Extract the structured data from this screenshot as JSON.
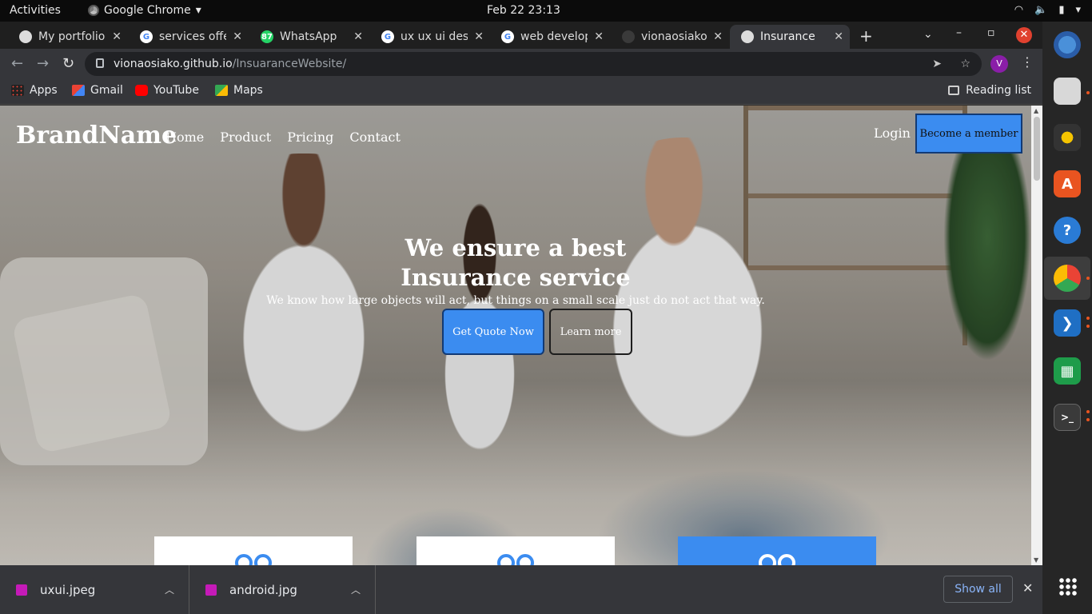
{
  "system_bar": {
    "activities": "Activities",
    "app_name": "Google Chrome",
    "datetime": "Feb 22  23:13"
  },
  "tabs": [
    {
      "label": "My portfolio",
      "icon": "globe-icon"
    },
    {
      "label": "services offe",
      "icon": "google-icon"
    },
    {
      "label": "WhatsApp",
      "icon": "whatsapp-icon",
      "badge": "87"
    },
    {
      "label": "ux ux ui desi",
      "icon": "google-icon"
    },
    {
      "label": "web develop",
      "icon": "google-icon"
    },
    {
      "label": "vionaosiako/",
      "icon": "github-icon"
    },
    {
      "label": "Insurance",
      "icon": "globe-icon",
      "active": true
    }
  ],
  "toolbar": {
    "url_host": "vionaosiako.github.io",
    "url_path": "/InsuaranceWebsite/",
    "profile_initial": "V"
  },
  "bookmarks": [
    {
      "label": "Apps",
      "icon": "apps-grid-icon"
    },
    {
      "label": "Gmail",
      "icon": "gmail-icon"
    },
    {
      "label": "YouTube",
      "icon": "youtube-icon"
    },
    {
      "label": "Maps",
      "icon": "maps-icon"
    }
  ],
  "reading_list": "Reading list",
  "site": {
    "brand": "BrandName",
    "nav": [
      "Home",
      "Product",
      "Pricing",
      "Contact"
    ],
    "login": "Login",
    "member_button": "Become a member",
    "hero_title": "We ensure a best Insurance service",
    "hero_subtitle": "We know how large objects will act, but things on a small scale just do not act that way.",
    "quote_button": "Get Quote Now",
    "learn_button": "Learn more"
  },
  "downloads": [
    {
      "filename": "uxui.jpeg"
    },
    {
      "filename": "android.jpg"
    }
  ],
  "download_shelf": {
    "show_all": "Show all"
  },
  "colors": {
    "accent_blue": "#3b8cf0",
    "chrome_dark": "#35363a",
    "close_red": "#e0412f"
  }
}
